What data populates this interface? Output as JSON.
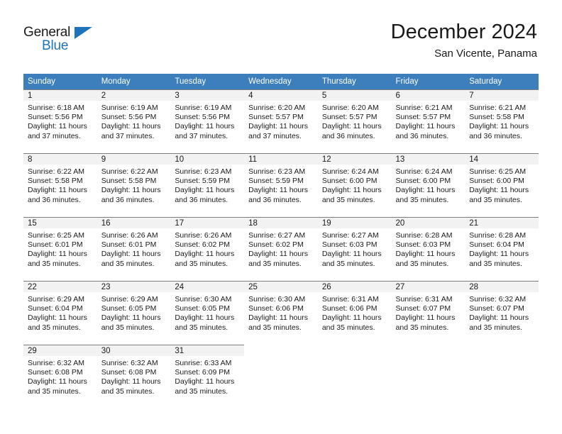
{
  "brand": {
    "name_part1": "General",
    "name_part2": "Blue",
    "triangle_color": "#1f73bd"
  },
  "header": {
    "title": "December 2024",
    "location": "San Vicente, Panama"
  },
  "colors": {
    "header_row": "#3d7ebd",
    "daynum_bar": "#f2f2f2",
    "rule": "#7d7d7d",
    "text": "#1a1a1a"
  },
  "calendar": {
    "weekday_headers": [
      "Sunday",
      "Monday",
      "Tuesday",
      "Wednesday",
      "Thursday",
      "Friday",
      "Saturday"
    ],
    "weeks": [
      [
        {
          "day": "1",
          "sunrise": "Sunrise: 6:18 AM",
          "sunset": "Sunset: 5:56 PM",
          "daylight": "Daylight: 11 hours and 37 minutes."
        },
        {
          "day": "2",
          "sunrise": "Sunrise: 6:19 AM",
          "sunset": "Sunset: 5:56 PM",
          "daylight": "Daylight: 11 hours and 37 minutes."
        },
        {
          "day": "3",
          "sunrise": "Sunrise: 6:19 AM",
          "sunset": "Sunset: 5:56 PM",
          "daylight": "Daylight: 11 hours and 37 minutes."
        },
        {
          "day": "4",
          "sunrise": "Sunrise: 6:20 AM",
          "sunset": "Sunset: 5:57 PM",
          "daylight": "Daylight: 11 hours and 37 minutes."
        },
        {
          "day": "5",
          "sunrise": "Sunrise: 6:20 AM",
          "sunset": "Sunset: 5:57 PM",
          "daylight": "Daylight: 11 hours and 36 minutes."
        },
        {
          "day": "6",
          "sunrise": "Sunrise: 6:21 AM",
          "sunset": "Sunset: 5:57 PM",
          "daylight": "Daylight: 11 hours and 36 minutes."
        },
        {
          "day": "7",
          "sunrise": "Sunrise: 6:21 AM",
          "sunset": "Sunset: 5:58 PM",
          "daylight": "Daylight: 11 hours and 36 minutes."
        }
      ],
      [
        {
          "day": "8",
          "sunrise": "Sunrise: 6:22 AM",
          "sunset": "Sunset: 5:58 PM",
          "daylight": "Daylight: 11 hours and 36 minutes."
        },
        {
          "day": "9",
          "sunrise": "Sunrise: 6:22 AM",
          "sunset": "Sunset: 5:58 PM",
          "daylight": "Daylight: 11 hours and 36 minutes."
        },
        {
          "day": "10",
          "sunrise": "Sunrise: 6:23 AM",
          "sunset": "Sunset: 5:59 PM",
          "daylight": "Daylight: 11 hours and 36 minutes."
        },
        {
          "day": "11",
          "sunrise": "Sunrise: 6:23 AM",
          "sunset": "Sunset: 5:59 PM",
          "daylight": "Daylight: 11 hours and 36 minutes."
        },
        {
          "day": "12",
          "sunrise": "Sunrise: 6:24 AM",
          "sunset": "Sunset: 6:00 PM",
          "daylight": "Daylight: 11 hours and 35 minutes."
        },
        {
          "day": "13",
          "sunrise": "Sunrise: 6:24 AM",
          "sunset": "Sunset: 6:00 PM",
          "daylight": "Daylight: 11 hours and 35 minutes."
        },
        {
          "day": "14",
          "sunrise": "Sunrise: 6:25 AM",
          "sunset": "Sunset: 6:00 PM",
          "daylight": "Daylight: 11 hours and 35 minutes."
        }
      ],
      [
        {
          "day": "15",
          "sunrise": "Sunrise: 6:25 AM",
          "sunset": "Sunset: 6:01 PM",
          "daylight": "Daylight: 11 hours and 35 minutes."
        },
        {
          "day": "16",
          "sunrise": "Sunrise: 6:26 AM",
          "sunset": "Sunset: 6:01 PM",
          "daylight": "Daylight: 11 hours and 35 minutes."
        },
        {
          "day": "17",
          "sunrise": "Sunrise: 6:26 AM",
          "sunset": "Sunset: 6:02 PM",
          "daylight": "Daylight: 11 hours and 35 minutes."
        },
        {
          "day": "18",
          "sunrise": "Sunrise: 6:27 AM",
          "sunset": "Sunset: 6:02 PM",
          "daylight": "Daylight: 11 hours and 35 minutes."
        },
        {
          "day": "19",
          "sunrise": "Sunrise: 6:27 AM",
          "sunset": "Sunset: 6:03 PM",
          "daylight": "Daylight: 11 hours and 35 minutes."
        },
        {
          "day": "20",
          "sunrise": "Sunrise: 6:28 AM",
          "sunset": "Sunset: 6:03 PM",
          "daylight": "Daylight: 11 hours and 35 minutes."
        },
        {
          "day": "21",
          "sunrise": "Sunrise: 6:28 AM",
          "sunset": "Sunset: 6:04 PM",
          "daylight": "Daylight: 11 hours and 35 minutes."
        }
      ],
      [
        {
          "day": "22",
          "sunrise": "Sunrise: 6:29 AM",
          "sunset": "Sunset: 6:04 PM",
          "daylight": "Daylight: 11 hours and 35 minutes."
        },
        {
          "day": "23",
          "sunrise": "Sunrise: 6:29 AM",
          "sunset": "Sunset: 6:05 PM",
          "daylight": "Daylight: 11 hours and 35 minutes."
        },
        {
          "day": "24",
          "sunrise": "Sunrise: 6:30 AM",
          "sunset": "Sunset: 6:05 PM",
          "daylight": "Daylight: 11 hours and 35 minutes."
        },
        {
          "day": "25",
          "sunrise": "Sunrise: 6:30 AM",
          "sunset": "Sunset: 6:06 PM",
          "daylight": "Daylight: 11 hours and 35 minutes."
        },
        {
          "day": "26",
          "sunrise": "Sunrise: 6:31 AM",
          "sunset": "Sunset: 6:06 PM",
          "daylight": "Daylight: 11 hours and 35 minutes."
        },
        {
          "day": "27",
          "sunrise": "Sunrise: 6:31 AM",
          "sunset": "Sunset: 6:07 PM",
          "daylight": "Daylight: 11 hours and 35 minutes."
        },
        {
          "day": "28",
          "sunrise": "Sunrise: 6:32 AM",
          "sunset": "Sunset: 6:07 PM",
          "daylight": "Daylight: 11 hours and 35 minutes."
        }
      ],
      [
        {
          "day": "29",
          "sunrise": "Sunrise: 6:32 AM",
          "sunset": "Sunset: 6:08 PM",
          "daylight": "Daylight: 11 hours and 35 minutes."
        },
        {
          "day": "30",
          "sunrise": "Sunrise: 6:32 AM",
          "sunset": "Sunset: 6:08 PM",
          "daylight": "Daylight: 11 hours and 35 minutes."
        },
        {
          "day": "31",
          "sunrise": "Sunrise: 6:33 AM",
          "sunset": "Sunset: 6:09 PM",
          "daylight": "Daylight: 11 hours and 35 minutes."
        },
        {
          "day": "",
          "sunrise": "",
          "sunset": "",
          "daylight": ""
        },
        {
          "day": "",
          "sunrise": "",
          "sunset": "",
          "daylight": ""
        },
        {
          "day": "",
          "sunrise": "",
          "sunset": "",
          "daylight": ""
        },
        {
          "day": "",
          "sunrise": "",
          "sunset": "",
          "daylight": ""
        }
      ]
    ]
  }
}
